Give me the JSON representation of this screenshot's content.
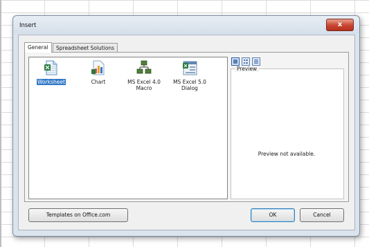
{
  "dialog": {
    "title": "Insert",
    "close_glyph": "x"
  },
  "tabs": [
    {
      "label": "General",
      "active": true
    },
    {
      "label": "Spreadsheet Solutions",
      "active": false
    }
  ],
  "items": [
    {
      "label": "Worksheet",
      "icon": "worksheet-icon",
      "selected": true
    },
    {
      "label": "Chart",
      "icon": "chart-icon",
      "selected": false
    },
    {
      "label": "MS Excel 4.0 Macro",
      "line1": "MS Excel 4.0",
      "line2": "Macro",
      "icon": "macro-icon",
      "selected": false
    },
    {
      "label": "MS Excel 5.0 Dialog",
      "line1": "MS Excel 5.0",
      "line2": "Dialog",
      "icon": "dialog-sheet-icon",
      "selected": false
    }
  ],
  "view_buttons": [
    "large-icons-view-icon",
    "list-view-icon",
    "details-view-icon"
  ],
  "preview": {
    "label": "Preview",
    "message": "Preview not available."
  },
  "buttons": {
    "templates": "Templates on Office.com",
    "ok": "OK",
    "cancel": "Cancel"
  },
  "colors": {
    "selection": "#3178c6",
    "close_button": "#c8442f",
    "dialog_frame": "#dbe3ec"
  }
}
